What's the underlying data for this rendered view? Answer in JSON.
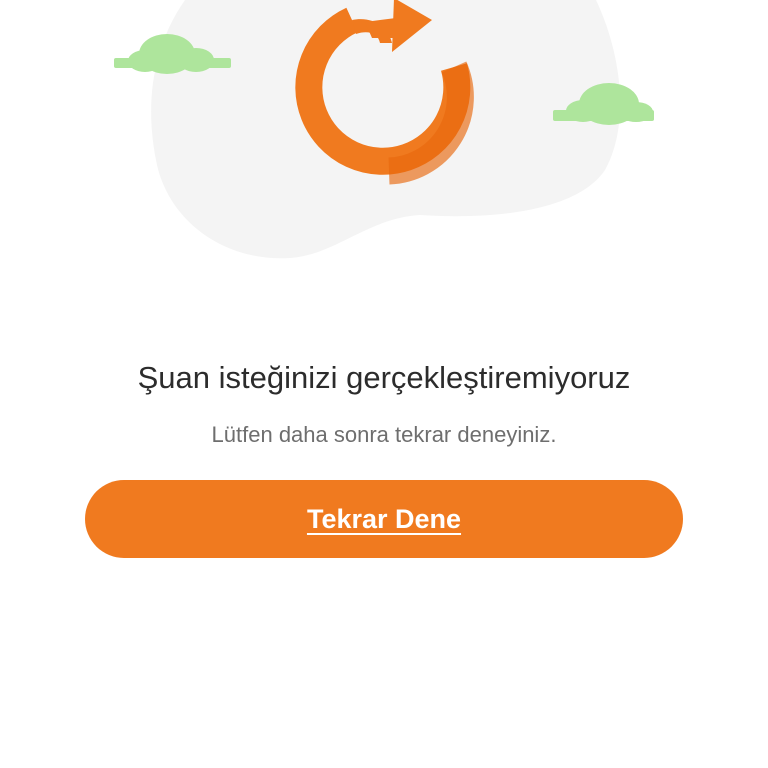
{
  "error": {
    "title": "Şuan isteğinizi gerçekleştiremiyoruz",
    "message": "Lütfen daha sonra tekrar deneyiniz."
  },
  "actions": {
    "retry_label": "Tekrar Dene"
  },
  "illustration": {
    "icon": "refresh-icon",
    "decorations": [
      "cloud-icon",
      "cloud-icon"
    ]
  },
  "colors": {
    "accent": "#f07a1f",
    "accent_dark": "#e8680e",
    "blob": "#f4f4f4",
    "cloud": "#aee59c",
    "title_text": "#2c2c2c",
    "subtitle_text": "#6e6e6e"
  }
}
